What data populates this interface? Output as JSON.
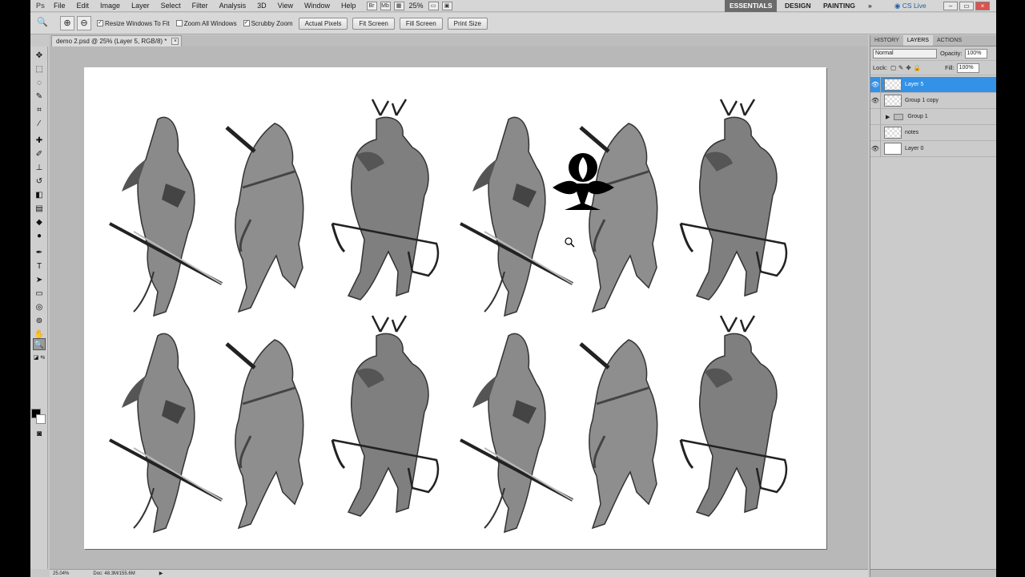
{
  "menubar": {
    "items": [
      "File",
      "Edit",
      "Image",
      "Layer",
      "Select",
      "Filter",
      "Analysis",
      "3D",
      "View",
      "Window",
      "Help"
    ],
    "bridge_label": "Br",
    "minibridge_label": "Mb",
    "zoom": "25%",
    "workspaces": [
      "ESSENTIALS",
      "DESIGN",
      "PAINTING"
    ],
    "more": "»",
    "cs_live": "CS Live"
  },
  "options": {
    "checks": [
      {
        "label": "Resize Windows To Fit",
        "checked": true
      },
      {
        "label": "Zoom All Windows",
        "checked": false
      },
      {
        "label": "Scrubby Zoom",
        "checked": true
      }
    ],
    "buttons": [
      "Actual Pixels",
      "Fit Screen",
      "Fill Screen",
      "Print Size"
    ]
  },
  "document": {
    "tab_title": "demo 2.psd @ 25% (Layer 5, RGB/8) *",
    "status_zoom": "25.04%",
    "status_doc": "Doc: 48.3M/155.6M"
  },
  "panel": {
    "tabs": [
      "HISTORY",
      "LAYERS",
      "ACTIONS"
    ],
    "active_tab": "LAYERS",
    "blend_mode": "Normal",
    "opacity_label": "Opacity:",
    "opacity": "100%",
    "lock_label": "Lock:",
    "fill_label": "Fill:",
    "fill": "100%",
    "layers": [
      {
        "name": "Layer 5",
        "visible": true,
        "selected": true,
        "kind": "layer"
      },
      {
        "name": "Group 1 copy",
        "visible": true,
        "selected": false,
        "kind": "layer"
      },
      {
        "name": "Group 1",
        "visible": false,
        "selected": false,
        "kind": "group"
      },
      {
        "name": "notes",
        "visible": false,
        "selected": false,
        "kind": "layer"
      },
      {
        "name": "Layer 0",
        "visible": true,
        "selected": false,
        "kind": "white"
      }
    ]
  },
  "colors": {
    "accent": "#3391e6",
    "workspace_active": "#6b6b6b"
  }
}
